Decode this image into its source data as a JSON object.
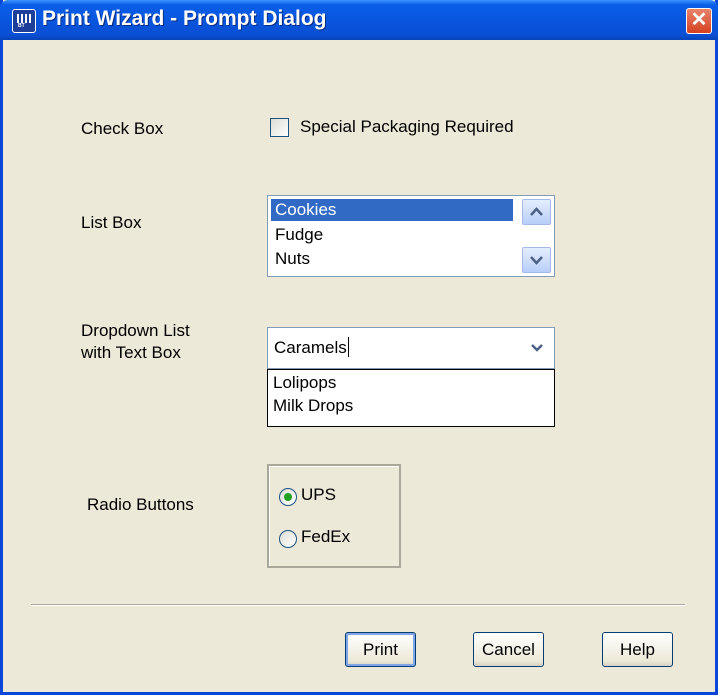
{
  "window": {
    "title": "Print Wizard - Prompt Dialog",
    "close_glyph": "✕",
    "icon": "barcode-app-icon",
    "icon_text": "BT"
  },
  "checkbox": {
    "label": "Check Box",
    "text": "Special Packaging Required",
    "checked": false
  },
  "listbox": {
    "label": "List Box",
    "items": [
      "Cookies",
      "Fudge",
      "Nuts"
    ],
    "selected": "Cookies"
  },
  "dropdown": {
    "label_line1": "Dropdown List",
    "label_line2": "with Text Box",
    "value": "Caramels",
    "options": [
      "Lolipops",
      "Milk Drops"
    ]
  },
  "radio": {
    "label": "Radio Buttons",
    "options": [
      "UPS",
      "FedEx"
    ],
    "selected": "UPS"
  },
  "buttons": {
    "print": "Print",
    "cancel": "Cancel",
    "help": "Help"
  },
  "colors": {
    "titlebar": "#0a5ee8",
    "selection": "#316ac5",
    "dialog_bg": "#ece9d8",
    "close": "#d4411f"
  }
}
